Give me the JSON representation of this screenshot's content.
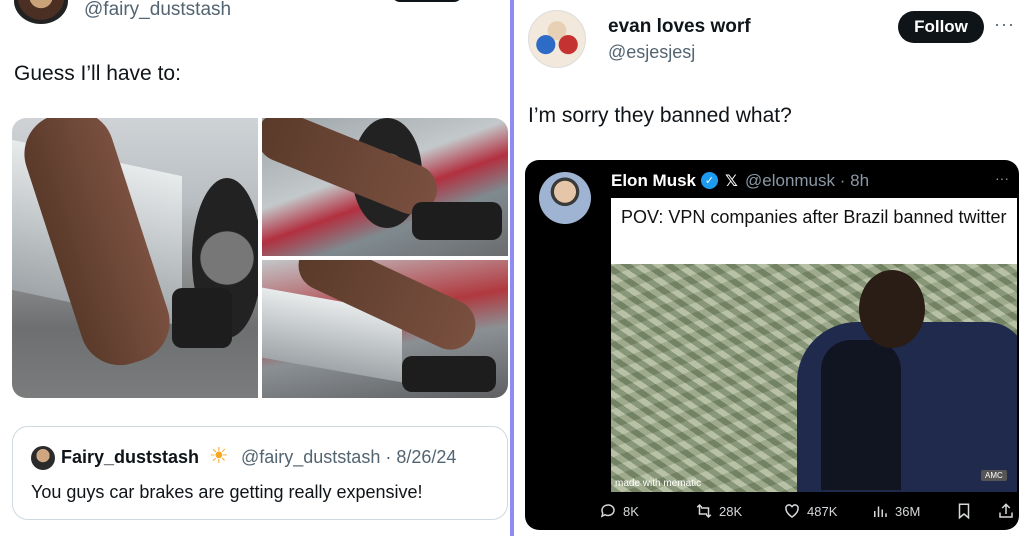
{
  "left_post": {
    "handle": "@fairy_duststash",
    "text": "Guess I’ll have to:",
    "quote": {
      "name": "Fairy_duststash",
      "emoji": "☀",
      "handle_date": "@fairy_duststash · 8/26/24",
      "text": "You guys car brakes are getting really expensive!"
    }
  },
  "right_post": {
    "name": "evan loves worf",
    "handle": "@esjesjesj",
    "follow_label": "Follow",
    "more": "···",
    "text": "I’m sorry they banned what?",
    "embedded": {
      "name": "Elon Musk",
      "verified_mark": "✓",
      "x_logo": "𝕏",
      "handle_time": "@elonmusk · 8h",
      "more": "···",
      "meme_caption": "POV: VPN companies after Brazil banned twitter",
      "watermark": "made with mematic",
      "network_logo": "AMC",
      "stats": {
        "replies": "8K",
        "reposts": "28K",
        "likes": "487K",
        "views": "36M"
      }
    }
  },
  "colors": {
    "divider": "#8e8cf2",
    "follow_bg": "#0f1419",
    "verified": "#1d9bf0",
    "muted": "#536471"
  }
}
